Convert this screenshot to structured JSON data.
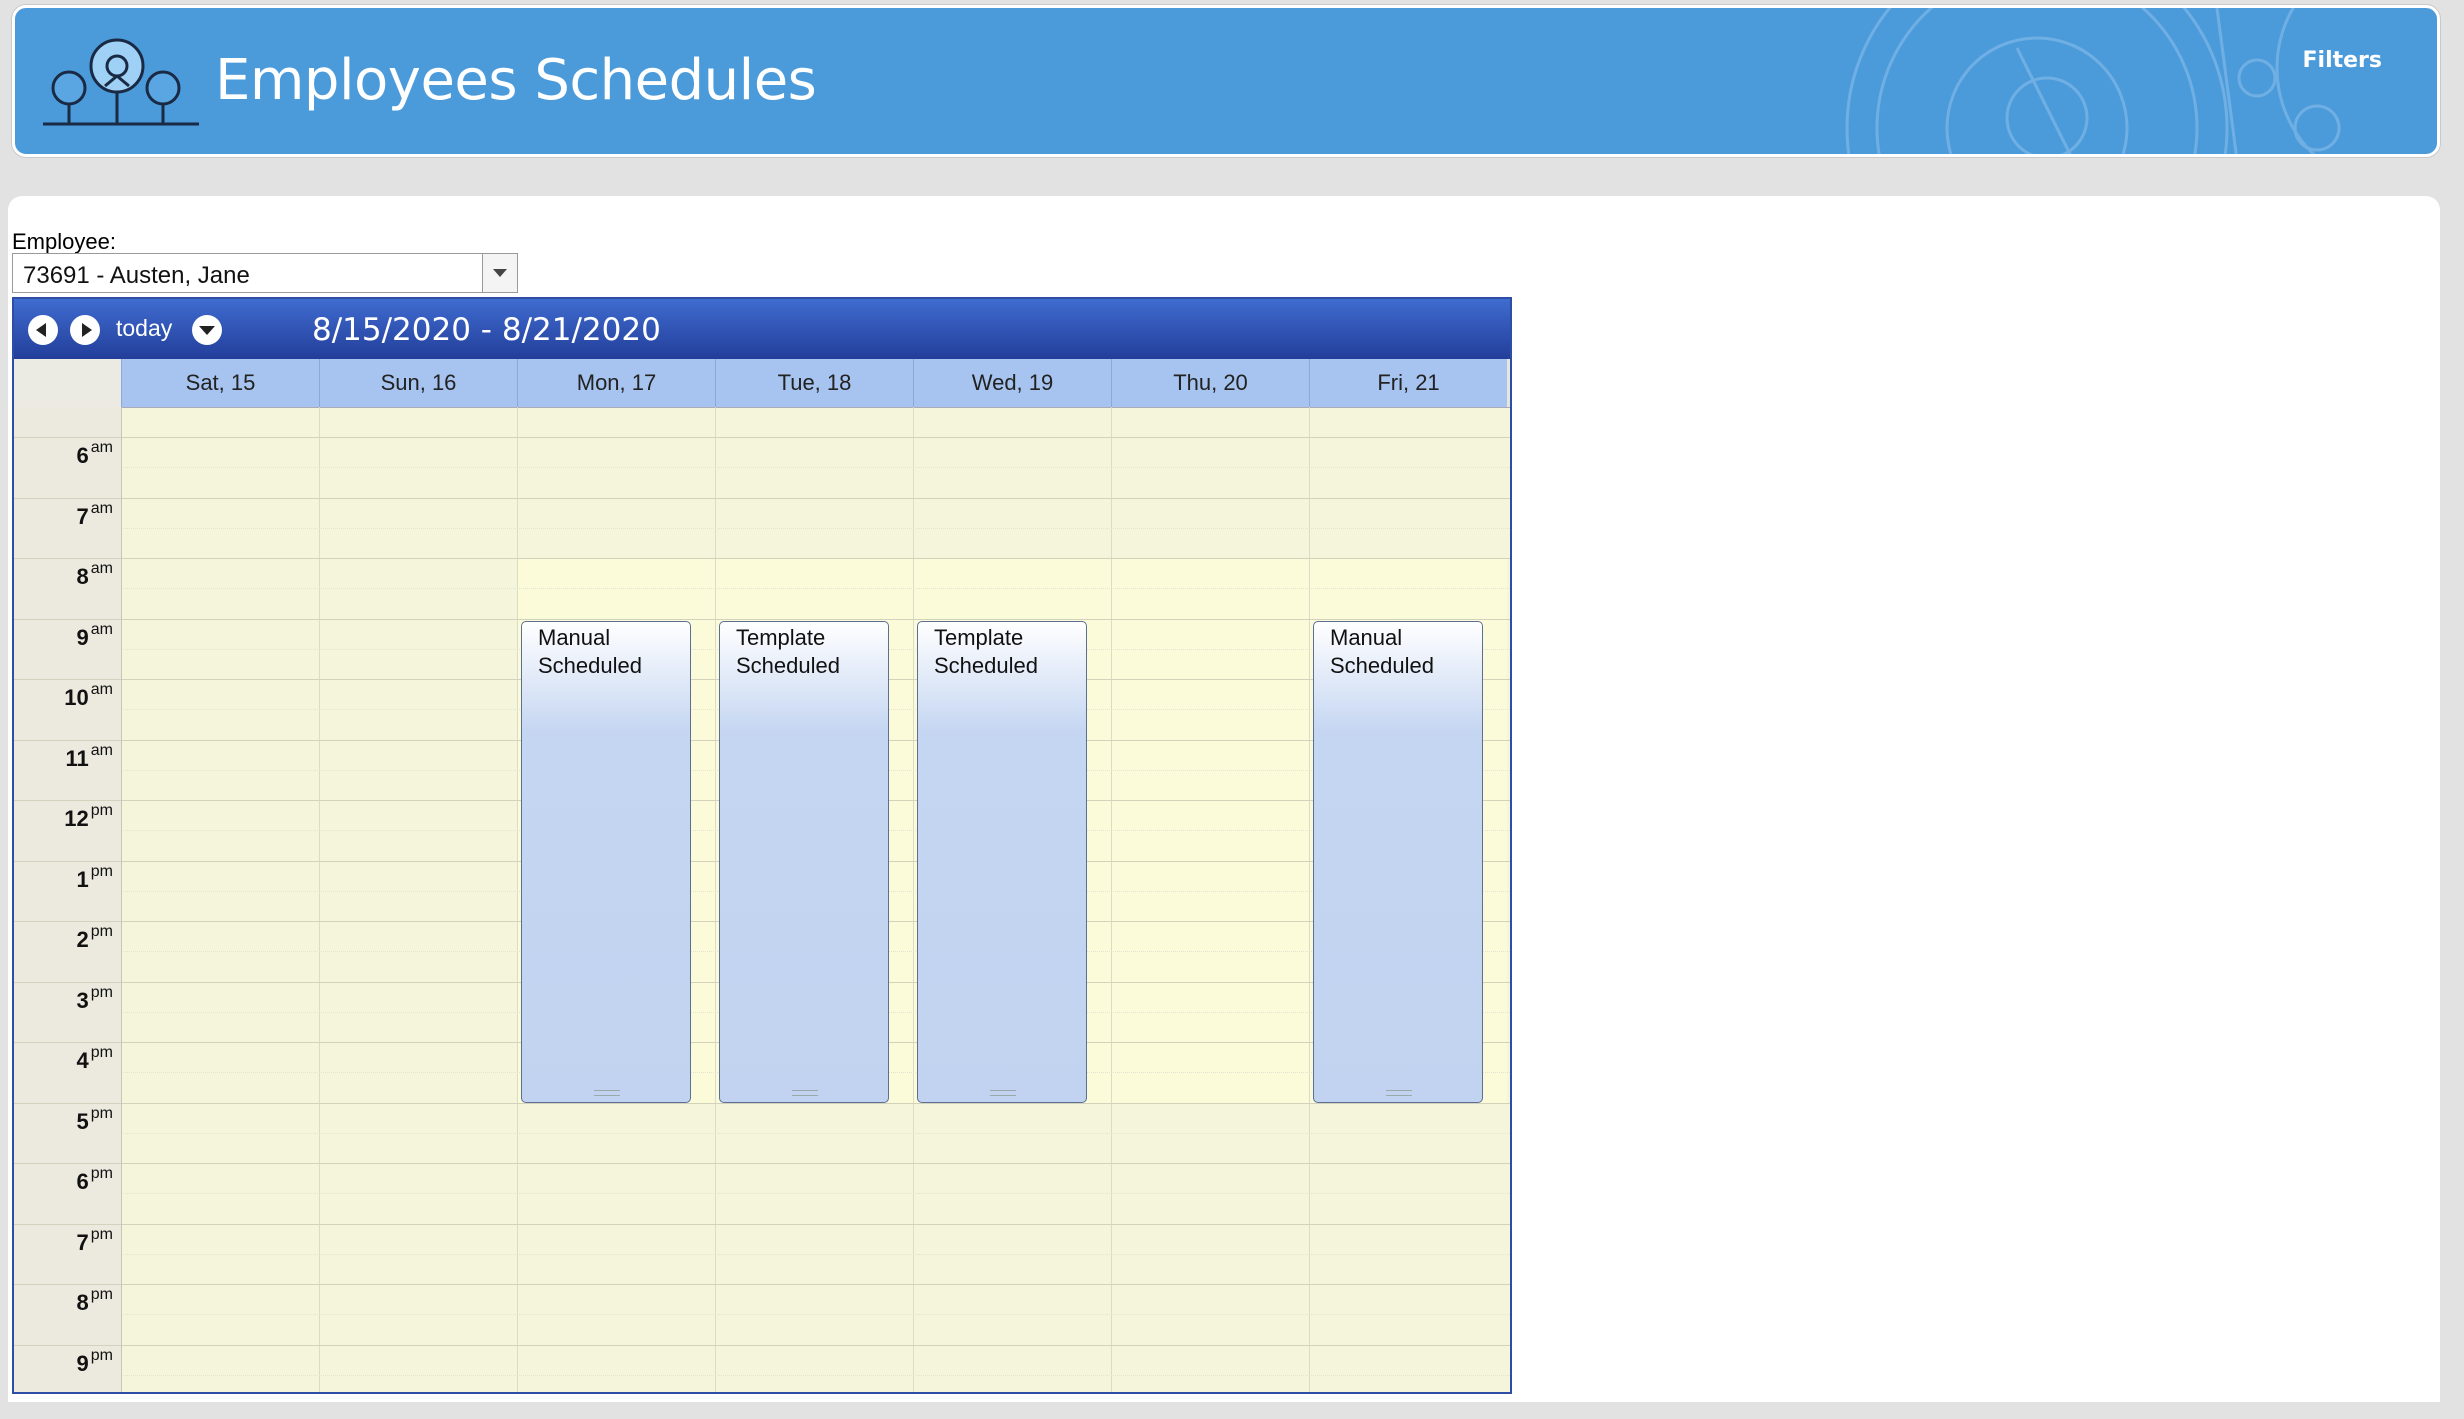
{
  "header": {
    "title": "Employees Schedules",
    "filters_label": "Filters",
    "brand_color": "#4b9bdb",
    "logo_icon": "tree-gear-logo-icon"
  },
  "employee": {
    "label": "Employee:",
    "selected": "73691 - Austen, Jane"
  },
  "calendar": {
    "today_label": "today",
    "date_range": "8/15/2020 - 8/21/2020",
    "days": [
      "Sat, 15",
      "Sun, 16",
      "Mon, 17",
      "Tue, 18",
      "Wed, 19",
      "Thu, 20",
      "Fri, 21"
    ],
    "hours": [
      {
        "h": "6",
        "ampm": "am"
      },
      {
        "h": "7",
        "ampm": "am"
      },
      {
        "h": "8",
        "ampm": "am"
      },
      {
        "h": "9",
        "ampm": "am"
      },
      {
        "h": "10",
        "ampm": "am"
      },
      {
        "h": "11",
        "ampm": "am"
      },
      {
        "h": "12",
        "ampm": "pm"
      },
      {
        "h": "1",
        "ampm": "pm"
      },
      {
        "h": "2",
        "ampm": "pm"
      },
      {
        "h": "3",
        "ampm": "pm"
      },
      {
        "h": "4",
        "ampm": "pm"
      },
      {
        "h": "5",
        "ampm": "pm"
      },
      {
        "h": "6",
        "ampm": "pm"
      },
      {
        "h": "7",
        "ampm": "pm"
      },
      {
        "h": "8",
        "ampm": "pm"
      },
      {
        "h": "9",
        "ampm": "pm"
      }
    ],
    "events": [
      {
        "day": "Mon, 17",
        "line1": "Manual",
        "line2": "Scheduled",
        "start": "9 am",
        "end": "5 pm"
      },
      {
        "day": "Tue, 18",
        "line1": "Template",
        "line2": "Scheduled",
        "start": "9 am",
        "end": "5 pm"
      },
      {
        "day": "Wed, 19",
        "line1": "Template",
        "line2": "Scheduled",
        "start": "9 am",
        "end": "5 pm"
      },
      {
        "day": "Fri, 21",
        "line1": "Manual",
        "line2": "Scheduled",
        "start": "9 am",
        "end": "5 pm"
      }
    ],
    "colors": {
      "toolbar": "#2c4fa5",
      "day_header": "#a6c4ef",
      "off_hours": "#f5f5dc",
      "work_hours": "#fbfbd9",
      "event": "#c1d3f0"
    }
  }
}
